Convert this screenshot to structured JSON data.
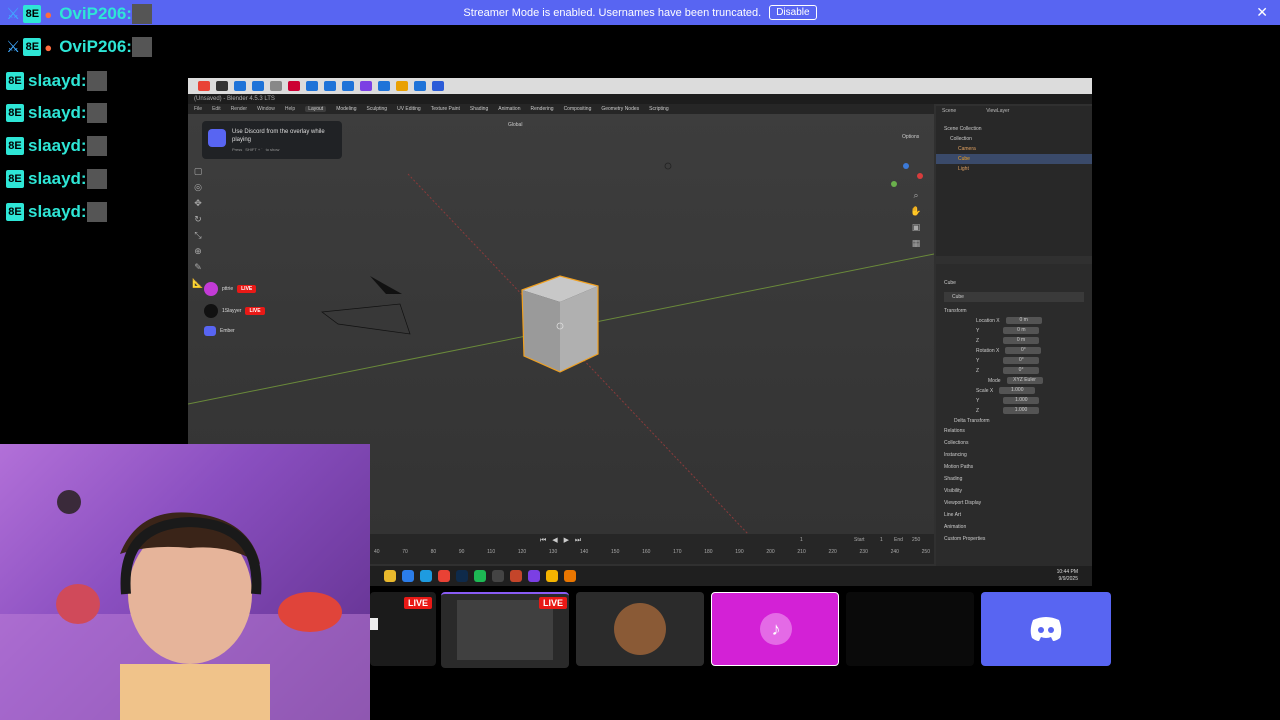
{
  "banner": {
    "message": "Streamer Mode is enabled. Usernames have been truncated.",
    "disable_label": "Disable",
    "close_glyph": "✕",
    "color": "#5865f2"
  },
  "chat": {
    "lines": [
      {
        "name": "OviP206:",
        "badge": "8E"
      },
      {
        "name": "OviP206:",
        "badge": "8E"
      },
      {
        "name": "slaayd:",
        "badge": "8E"
      },
      {
        "name": "slaayd:",
        "badge": "8E"
      },
      {
        "name": "slaayd:",
        "badge": "8E"
      },
      {
        "name": "slaayd:",
        "badge": "8E"
      },
      {
        "name": "slaayd:",
        "badge": "8E"
      }
    ],
    "name_color": "#2ee6d6"
  },
  "blender": {
    "title": "(Unsaved) - Blender 4.5.3 LTS",
    "menus": [
      "File",
      "Edit",
      "Render",
      "Window",
      "Help"
    ],
    "workspaces": [
      "Layout",
      "Modeling",
      "Sculpting",
      "UV Editing",
      "Texture Paint",
      "Shading",
      "Animation",
      "Rendering",
      "Compositing",
      "Geometry Nodes",
      "Scripting"
    ],
    "active_workspace": "Layout",
    "orientation": "Global",
    "scene_label": "Scene",
    "view_layer_label": "ViewLayer",
    "options_label": "Options",
    "outliner": {
      "header": "Scene Collection",
      "collection": "Collection",
      "items": [
        "Camera",
        "Cube",
        "Light"
      ]
    },
    "properties": {
      "object_name": "Cube",
      "mesh_name": "Cube",
      "transform_label": "Transform",
      "location_label": "Location X",
      "rotation_label": "Rotation X",
      "scale_label": "Scale X",
      "mode_label": "Mode",
      "mode_value": "XYZ Euler",
      "y_label": "Y",
      "z_label": "Z",
      "location_values": [
        "0 m",
        "0 m",
        "0 m"
      ],
      "rotation_values": [
        "0°",
        "0°",
        "0°"
      ],
      "scale_values": [
        "1.000",
        "1.000",
        "1.000"
      ],
      "delta_transform": "Delta Transform",
      "panels": [
        "Relations",
        "Collections",
        "Instancing",
        "Motion Paths",
        "Shading",
        "Visibility",
        "Viewport Display",
        "Line Art",
        "Animation",
        "Custom Properties"
      ]
    },
    "timeline": {
      "ticks": [
        "40",
        "70",
        "80",
        "90",
        "110",
        "120",
        "130",
        "140",
        "150",
        "160",
        "170",
        "180",
        "190",
        "200",
        "210",
        "220",
        "230",
        "240",
        "250"
      ],
      "current_frame": "1",
      "start_label": "Start",
      "start_value": "1",
      "end_label": "End",
      "end_value": "250"
    },
    "clock": "10:44 PM",
    "date": "9/9/2025"
  },
  "discord_overlay": {
    "text": "Use Discord from the overlay while playing",
    "hint_prefix": "Press",
    "hint_key": "SHIFT + `",
    "hint_suffix": "to show",
    "participants": [
      {
        "name": "pttrie",
        "badge": "LIVE"
      },
      {
        "name": "1Slayyer",
        "badge": "LIVE"
      },
      {
        "name": "Ember",
        "badge": ""
      }
    ]
  },
  "tiles": {
    "live_badge": "LIVE",
    "discord_color": "#5865f2",
    "pink_color": "#d321d6"
  }
}
